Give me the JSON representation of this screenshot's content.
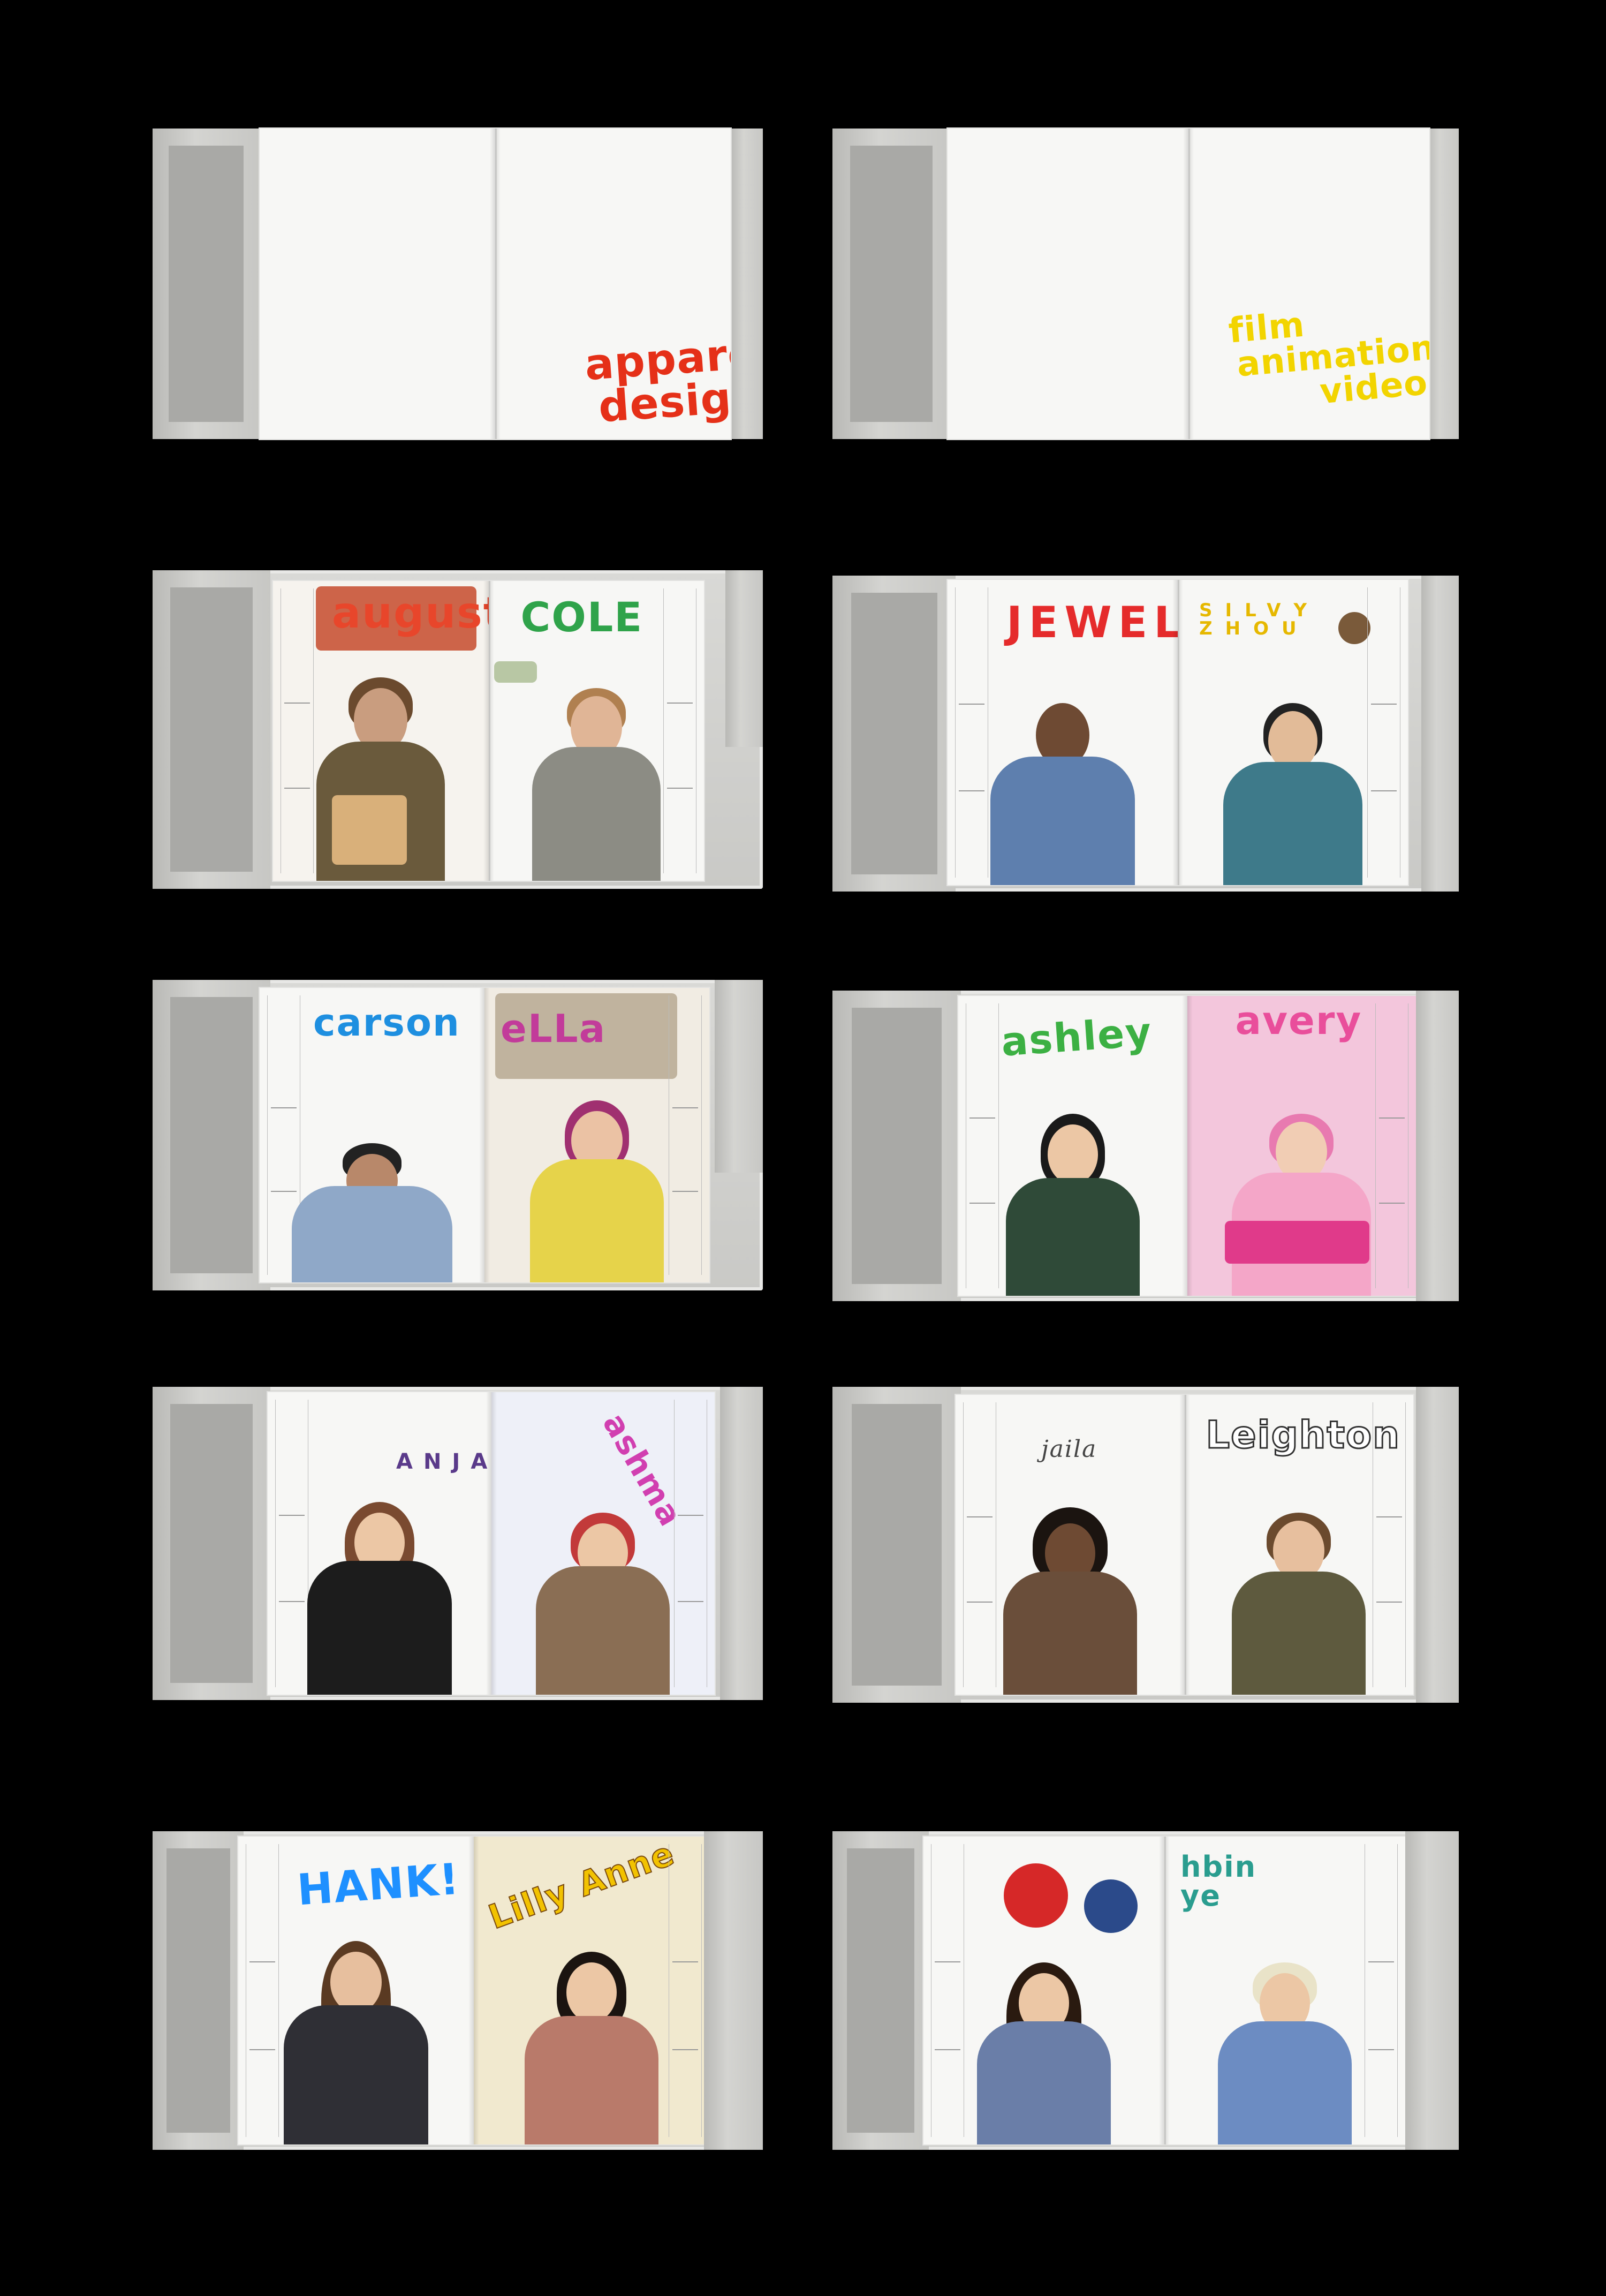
{
  "rows": [
    {
      "left": {
        "section": [
          "apparel",
          "design"
        ],
        "color": "#e53018"
      },
      "right": {
        "section": [
          "film",
          "animation",
          "video"
        ],
        "color": "#f2d400"
      }
    }
  ],
  "spreads": [
    {
      "left_name": "august",
      "right_name": "COLE",
      "left_color": "#e8462b",
      "right_color": "#2fa34a"
    },
    {
      "left_name": "JEWEL",
      "right_name": "SILVY ZHOU",
      "left_color": "#e52b2b",
      "right_color": "#e6b800"
    },
    {
      "left_name": "carson",
      "right_name": "eLLa",
      "left_color": "#1e8fe0",
      "right_color": "#c23b9a"
    },
    {
      "left_name": "ashley",
      "right_name": "avery",
      "left_color": "#3cb043",
      "right_color": "#e94e9b"
    },
    {
      "left_name": "ANJA",
      "right_name": "ashma",
      "left_color": "#5a3a8a",
      "right_color": "#d13fb0"
    },
    {
      "left_name": "jaila",
      "right_name": "Leighton",
      "left_color": "#444444",
      "right_color": "#333333"
    },
    {
      "left_name": "HANK!",
      "right_name": "Lilly Anne",
      "left_color": "#1e90ff",
      "right_color": "#f2c200"
    },
    {
      "left_name": "",
      "right_name": "hbin ye",
      "left_color": "#d62828",
      "right_color": "#2a9d8f"
    }
  ]
}
